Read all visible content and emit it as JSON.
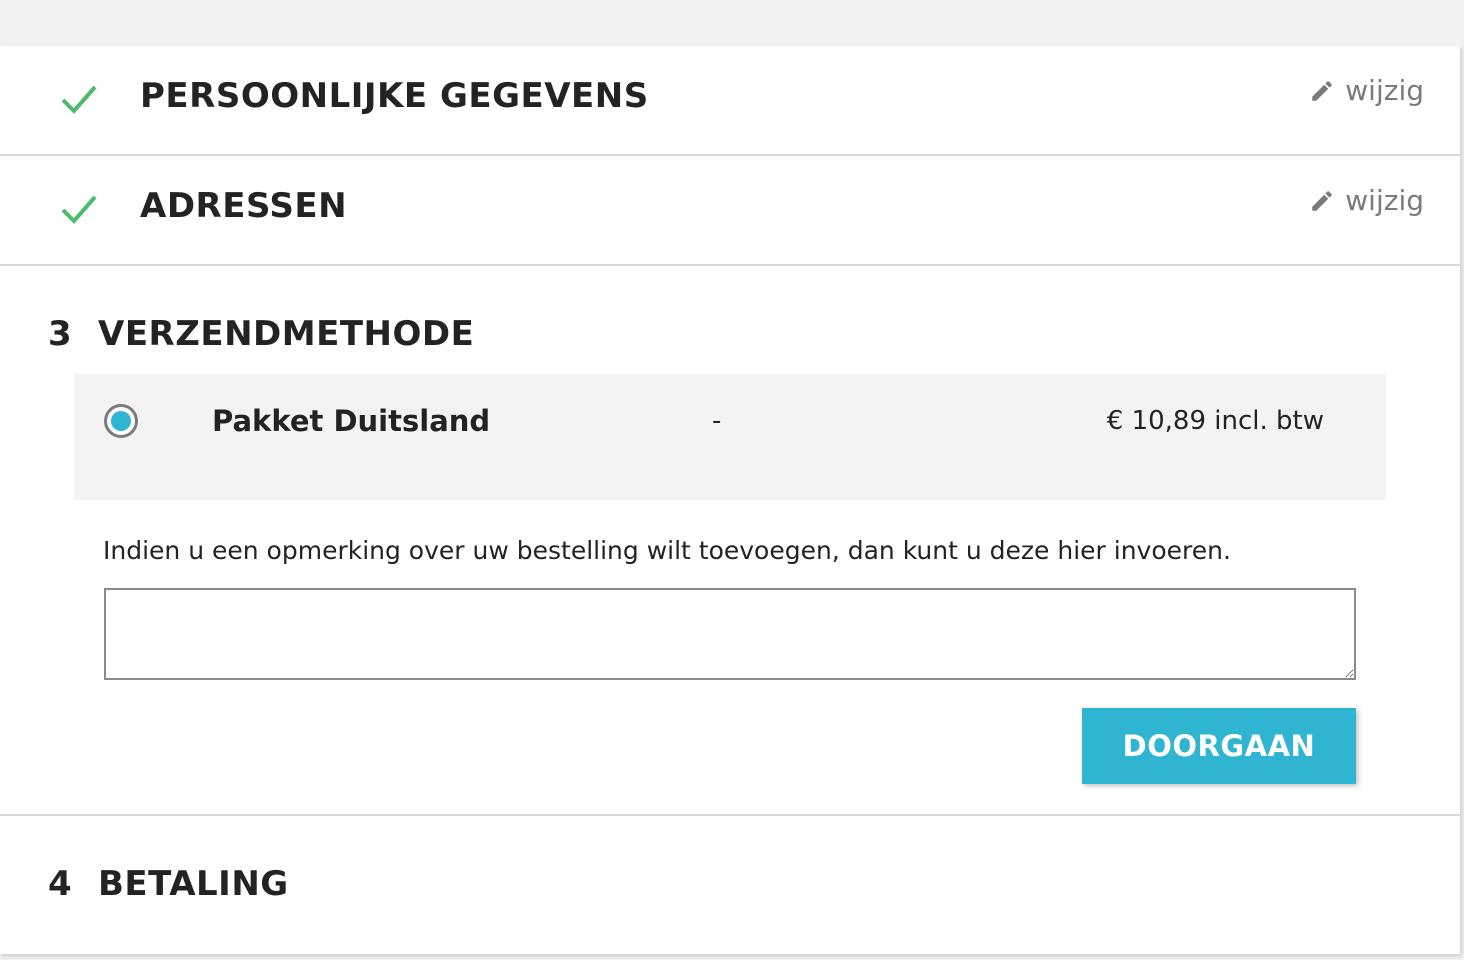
{
  "steps": {
    "personal": {
      "title": "PERSOONLIJKE GEGEVENS",
      "edit_label": "wijzig",
      "completed": true
    },
    "addresses": {
      "title": "ADRESSEN",
      "edit_label": "wijzig",
      "completed": true
    },
    "delivery": {
      "number": "3",
      "title": "VERZENDMETHODE",
      "options": [
        {
          "name": "Pakket Duitsland",
          "delay": "-",
          "price": "€ 10,89 incl. btw",
          "selected": true
        }
      ],
      "comment_label": "Indien u een opmerking over uw bestelling wilt toevoegen, dan kunt u deze hier invoeren.",
      "comment_value": "",
      "continue_label": "DOORGAAN"
    },
    "payment": {
      "number": "4",
      "title": "BETALING"
    }
  },
  "colors": {
    "accent": "#2fb5d2",
    "check": "#4cbb6c",
    "edit_text": "#7a7a7a",
    "option_bg": "#f3f3f3"
  },
  "icons": {
    "completed": "check-icon",
    "edit": "pencil-icon"
  }
}
